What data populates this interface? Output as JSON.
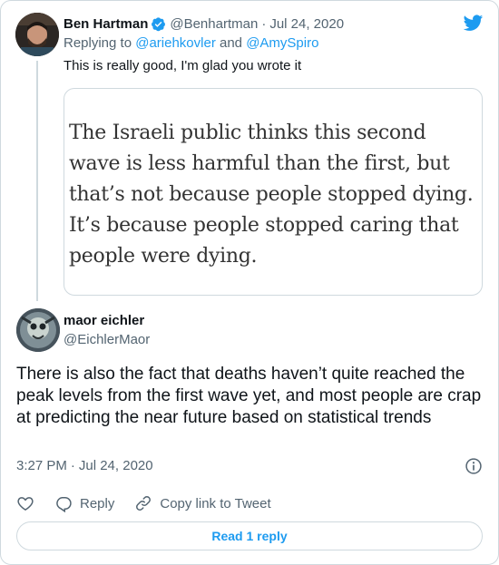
{
  "tweet1": {
    "author_name": "Ben Hartman",
    "author_handle": "@Benhartman",
    "date_separator": "·",
    "date": "Jul 24, 2020",
    "reply_prefix": "Replying to",
    "reply_to_1": "@ariehkovler",
    "reply_and": "and",
    "reply_to_2": "@AmySpiro",
    "text": "This is really good, I'm glad you wrote it",
    "quote_image_text": "The Israeli public thinks this second wave is less harmful than the first, but that’s not because people stopped dying. It’s because people stopped caring that people were dying."
  },
  "tweet2": {
    "author_name": "maor eichler",
    "author_handle": "@EichlerMaor",
    "text": "There is also the fact that deaths haven’t quite reached the peak levels from the first wave yet, and most people are crap at predicting the near future based on statistical trends",
    "time": "3:27 PM",
    "date_separator": "·",
    "date": "Jul 24, 2020"
  },
  "actions": {
    "reply_label": "Reply",
    "copy_link_label": "Copy link to Tweet"
  },
  "read_replies_label": "Read 1 reply",
  "icons": [
    "verified-icon",
    "twitter-bird-icon",
    "info-icon",
    "heart-icon",
    "reply-icon",
    "link-icon"
  ],
  "colors": {
    "accent": "#1d9bf0",
    "text": "#0f1419",
    "muted": "#536471",
    "border": "#cfd9de"
  }
}
